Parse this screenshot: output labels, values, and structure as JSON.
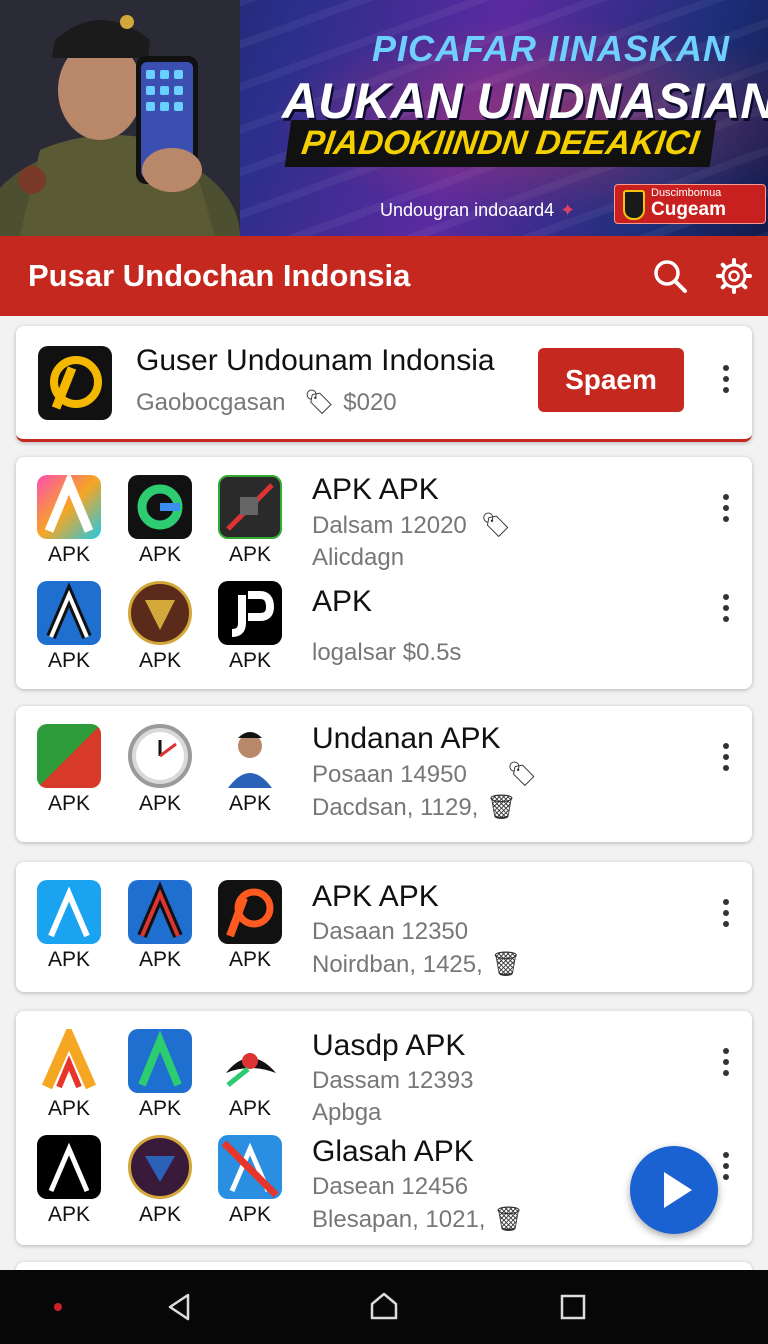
{
  "banner": {
    "line1": "PICAFAR IINASKAN",
    "line2": "AUKAN UNDNASIAN",
    "line3": "PIADOKIINDN DEEAKICI",
    "small_text": "Undougran indoaard4",
    "badge_small": "Duscimbomua",
    "badge_title": "Cugeam"
  },
  "toolbar": {
    "title": "Pusar Undochan Indonsia",
    "search_icon": "search-icon",
    "settings_icon": "gear-icon"
  },
  "featured": {
    "app_name": "Guser Undounam Indonsia",
    "subtitle": "Gaobocgasan",
    "price": "$020",
    "action_label": "Spaem"
  },
  "cards": [
    {
      "apps": [
        {
          "label": "APK",
          "color": "#f5a623"
        },
        {
          "label": "APK",
          "color": "#111111"
        },
        {
          "label": "APK",
          "color": "#2a2a2a"
        },
        {
          "label": "APK",
          "color": "#1f6fd1"
        },
        {
          "label": "APK",
          "color": "#5a2a1a"
        },
        {
          "label": "APK",
          "color": "#000000"
        }
      ],
      "entries": [
        {
          "name": "APK APK",
          "line2": "Dalsam 12020",
          "line3": "Alicdagn"
        },
        {
          "name": "APK",
          "line2": "",
          "line3": "logalsar $0.5s"
        }
      ]
    },
    {
      "apps": [
        {
          "label": "APK",
          "color": "#2e9b3a"
        },
        {
          "label": "APK",
          "color": "#d9d9d9"
        },
        {
          "label": "APK",
          "color": "#ffffff"
        }
      ],
      "entries": [
        {
          "name": "Undanan APK",
          "line2": "Posaan 14950",
          "line3": "Dacdsan, 1129,"
        }
      ]
    },
    {
      "apps": [
        {
          "label": "APK",
          "color": "#1aa3f0"
        },
        {
          "label": "APK",
          "color": "#1f6fd1"
        },
        {
          "label": "APK",
          "color": "#111111"
        }
      ],
      "entries": [
        {
          "name": "APK APK",
          "line2": "Dasaan 12350",
          "line3": "Noirdban, 1425,"
        }
      ]
    },
    {
      "apps": [
        {
          "label": "APK",
          "color": "#f5a623"
        },
        {
          "label": "APK",
          "color": "#1f6fd1"
        },
        {
          "label": "APK",
          "color": "#ffffff"
        },
        {
          "label": "APK",
          "color": "#000000"
        },
        {
          "label": "APK",
          "color": "#3a1a3a"
        },
        {
          "label": "APK",
          "color": "#2a8fe0"
        }
      ],
      "entries": [
        {
          "name": "Uasdp APK",
          "line2": "Dassam 12393",
          "line3": "Apbga"
        },
        {
          "name": "Glasah APK",
          "line2": "Dasean 12456",
          "line3": "Blesapan, 1021,"
        }
      ]
    }
  ],
  "fab": {
    "icon": "play-icon"
  },
  "navbar": {
    "back_icon": "back-icon",
    "home_icon": "home-icon",
    "recents_icon": "recents-icon"
  }
}
